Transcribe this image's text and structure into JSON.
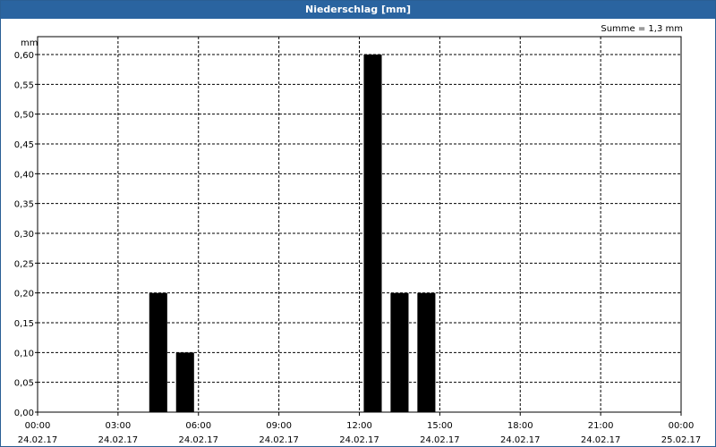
{
  "window": {
    "title": "Niederschlag [mm]"
  },
  "summary": {
    "text": "Summe = 1,3 mm"
  },
  "chart_data": {
    "type": "bar",
    "title": "Niederschlag [mm]",
    "ylabel": "mm",
    "xlabel": "",
    "ylim": [
      0,
      0.6
    ],
    "yticks": [
      "0,00",
      "0,05",
      "0,10",
      "0,15",
      "0,20",
      "0,25",
      "0,30",
      "0,35",
      "0,40",
      "0,45",
      "0,50",
      "0,55",
      "0,60"
    ],
    "xlim_hours": [
      0,
      24
    ],
    "xticks": [
      {
        "time": "00:00",
        "date": "24.02.17",
        "hour": 0
      },
      {
        "time": "03:00",
        "date": "24.02.17",
        "hour": 3
      },
      {
        "time": "06:00",
        "date": "24.02.17",
        "hour": 6
      },
      {
        "time": "09:00",
        "date": "24.02.17",
        "hour": 9
      },
      {
        "time": "12:00",
        "date": "24.02.17",
        "hour": 12
      },
      {
        "time": "15:00",
        "date": "24.02.17",
        "hour": 15
      },
      {
        "time": "18:00",
        "date": "24.02.17",
        "hour": 18
      },
      {
        "time": "21:00",
        "date": "24.02.17",
        "hour": 21
      },
      {
        "time": "00:00",
        "date": "25.02.17",
        "hour": 24
      }
    ],
    "bars": [
      {
        "hour": 4.5,
        "value": 0.2
      },
      {
        "hour": 5.5,
        "value": 0.1
      },
      {
        "hour": 12.5,
        "value": 0.6
      },
      {
        "hour": 13.5,
        "value": 0.2
      },
      {
        "hour": 14.5,
        "value": 0.2
      }
    ],
    "grid": true,
    "bar_color": "#000000"
  }
}
